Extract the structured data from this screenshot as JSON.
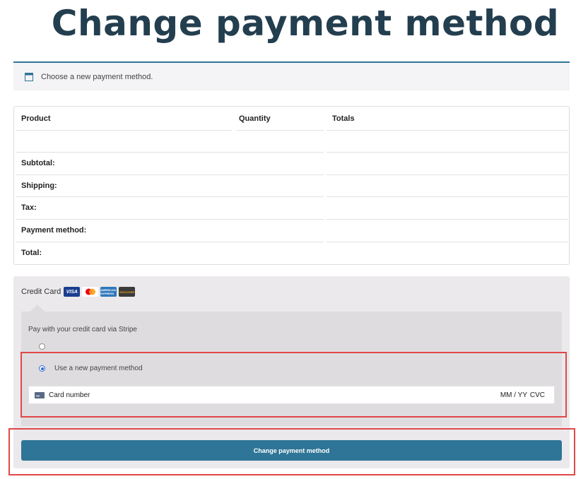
{
  "page": {
    "title": "Change payment method"
  },
  "notice": {
    "text": "Choose a new payment method.",
    "icon": "calendar-icon"
  },
  "order_table": {
    "headers": {
      "product": "Product",
      "quantity": "Quantity",
      "totals": "Totals"
    },
    "summary_rows": [
      {
        "label": "Subtotal:",
        "value": ""
      },
      {
        "label": "Shipping:",
        "value": ""
      },
      {
        "label": "Tax:",
        "value": ""
      },
      {
        "label": "Payment method:",
        "value": ""
      },
      {
        "label": "Total:",
        "value": ""
      }
    ]
  },
  "payment": {
    "method_label": "Credit Card",
    "card_logos": [
      {
        "name": "visa-logo",
        "text": "VISA"
      },
      {
        "name": "mastercard-logo",
        "text": ""
      },
      {
        "name": "amex-logo",
        "text": "AMERICAN EXPRESS"
      },
      {
        "name": "discover-logo",
        "text": "DISCOVER"
      }
    ],
    "description": "Pay with your credit card via Stripe",
    "saved_option_selected": false,
    "new_option_label": "Use a new payment method",
    "new_option_selected": true,
    "card_number_placeholder": "Card number",
    "expiry_placeholder": "MM / YY",
    "cvc_placeholder": "CVC",
    "submit_label": "Change payment method"
  },
  "colors": {
    "title": "#233e4f",
    "accent": "#2e7597",
    "highlight": "#e04848",
    "radio_selected": "#2c6fd6"
  }
}
